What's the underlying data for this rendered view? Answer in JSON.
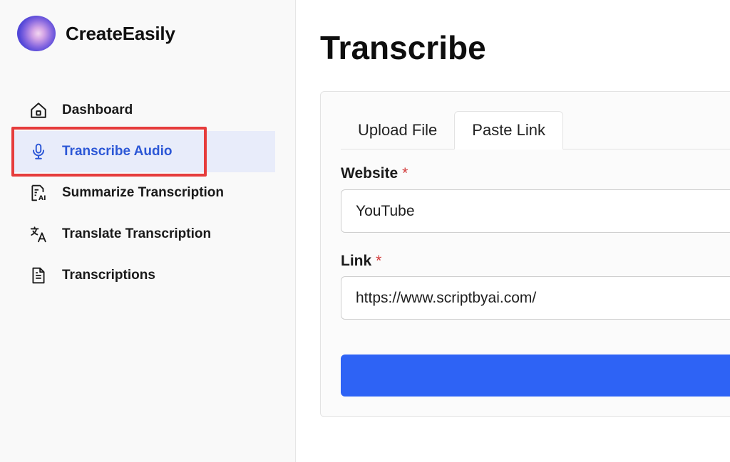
{
  "brand": {
    "name": "CreateEasily"
  },
  "sidebar": {
    "items": [
      {
        "label": "Dashboard",
        "icon": "home-icon"
      },
      {
        "label": "Transcribe Audio",
        "icon": "microphone-icon",
        "active": true
      },
      {
        "label": "Summarize Transcription",
        "icon": "document-ai-icon"
      },
      {
        "label": "Translate Transcription",
        "icon": "translate-icon"
      },
      {
        "label": "Transcriptions",
        "icon": "document-icon"
      }
    ]
  },
  "main": {
    "title": "Transcribe",
    "tabs": [
      {
        "label": "Upload File",
        "active": false
      },
      {
        "label": "Paste Link",
        "active": true
      }
    ],
    "form": {
      "website": {
        "label": "Website",
        "required_mark": "*",
        "value": "YouTube"
      },
      "link": {
        "label": "Link",
        "required_mark": "*",
        "value": "https://www.scriptbyai.com/"
      }
    }
  },
  "colors": {
    "accent": "#2e63f5",
    "active_nav_text": "#2c57d6",
    "active_nav_bg": "#e8ecfa",
    "highlight": "#e63c3c",
    "required": "#d23c3c"
  }
}
